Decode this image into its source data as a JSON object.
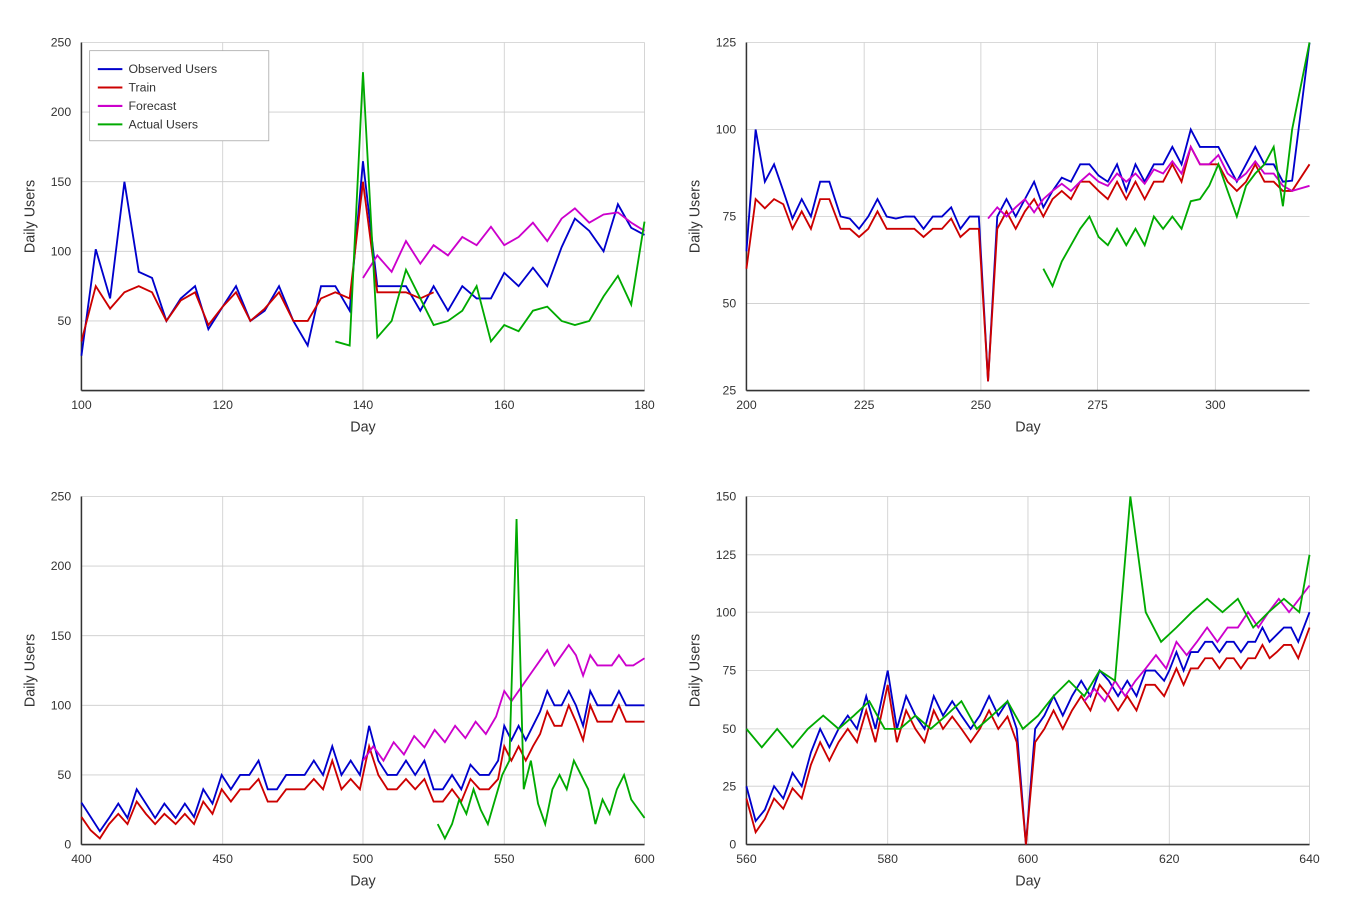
{
  "charts": [
    {
      "id": "chart-top-left",
      "xLabel": "Day",
      "yLabel": "Daily Users",
      "xRange": [
        100,
        180
      ],
      "yRange": [
        0,
        250
      ],
      "xTicks": [
        100,
        120,
        140,
        160,
        180
      ],
      "yTicks": [
        50,
        100,
        150,
        200,
        250
      ],
      "legend": [
        {
          "label": "Observed Users",
          "color": "#0000cc"
        },
        {
          "label": "Train",
          "color": "#cc0000"
        },
        {
          "label": "Forecast",
          "color": "#cc00cc"
        },
        {
          "label": "Actual Users",
          "color": "#00aa00"
        }
      ]
    },
    {
      "id": "chart-top-right",
      "xLabel": "Day",
      "yLabel": "Daily Users",
      "xRange": [
        200,
        320
      ],
      "yRange": [
        25,
        125
      ],
      "xTicks": [
        200,
        225,
        250,
        275,
        300
      ],
      "yTicks": [
        25,
        50,
        75,
        100,
        125
      ],
      "legend": []
    },
    {
      "id": "chart-bottom-left",
      "xLabel": "Day",
      "yLabel": "Daily Users",
      "xRange": [
        400,
        600
      ],
      "yRange": [
        0,
        250
      ],
      "xTicks": [
        400,
        450,
        500,
        550,
        600
      ],
      "yTicks": [
        0,
        50,
        100,
        150,
        200,
        250
      ],
      "legend": []
    },
    {
      "id": "chart-bottom-right",
      "xLabel": "Day",
      "yLabel": "Daily Users",
      "xRange": [
        560,
        640
      ],
      "yRange": [
        0,
        150
      ],
      "xTicks": [
        560,
        580,
        600,
        620,
        640
      ],
      "yTicks": [
        0,
        25,
        50,
        75,
        100,
        125,
        150
      ],
      "legend": []
    }
  ]
}
